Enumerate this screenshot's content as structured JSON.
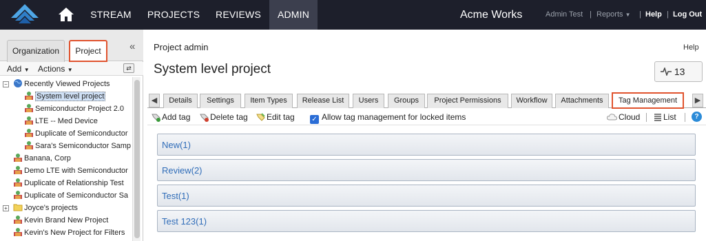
{
  "nav": {
    "tabs": [
      "STREAM",
      "PROJECTS",
      "REVIEWS",
      "ADMIN"
    ],
    "active_tab": "ADMIN",
    "brand": "Acme Works",
    "user": "Admin Test",
    "reports": "Reports",
    "help": "Help",
    "logout": "Log Out",
    "separator": "|"
  },
  "left_panel": {
    "tabs": [
      "Organization",
      "Project"
    ],
    "active_tab": "Project",
    "add_label": "Add",
    "actions_label": "Actions",
    "tree": [
      {
        "label": "Recently Viewed Projects",
        "icon": "globe-icon"
      },
      {
        "label": "System level project",
        "icon": "project-icon",
        "selected": true
      },
      {
        "label": "Semiconductor Project 2.0",
        "icon": "project-icon"
      },
      {
        "label": "LTE -- Med Device",
        "icon": "project-icon"
      },
      {
        "label": "Duplicate of Semiconductor",
        "icon": "project-icon"
      },
      {
        "label": "Sara's Semiconductor Samp",
        "icon": "project-icon"
      },
      {
        "label": "Banana, Corp",
        "icon": "project-icon"
      },
      {
        "label": "Demo LTE with Semiconductor",
        "icon": "project-icon"
      },
      {
        "label": "Duplicate of Relationship Test",
        "icon": "project-icon"
      },
      {
        "label": "Duplicate of Semiconductor Sa",
        "icon": "project-icon"
      },
      {
        "label": "Joyce's projects",
        "icon": "folder-icon"
      },
      {
        "label": "Kevin Brand New Project",
        "icon": "project-icon"
      },
      {
        "label": "Kevin's New Project for Filters",
        "icon": "project-icon"
      }
    ]
  },
  "main": {
    "page_title": "Project admin",
    "help": "Help",
    "project_name": "System level project",
    "pulse_count": "13",
    "tabs": [
      "Details",
      "Settings",
      "Item Types",
      "Release List",
      "Users",
      "Groups",
      "Project Permissions",
      "Workflow",
      "Attachments",
      "Tag Management"
    ],
    "active_tab": "Tag Management",
    "toolbar": {
      "add_tag": "Add tag",
      "delete_tag": "Delete tag",
      "edit_tag": "Edit tag",
      "allow_locked": "Allow tag management for locked items",
      "allow_locked_checked": true,
      "cloud": "Cloud",
      "list": "List"
    },
    "tags": [
      "New(1)",
      "Review(2)",
      "Test(1)",
      "Test 123(1)"
    ]
  }
}
